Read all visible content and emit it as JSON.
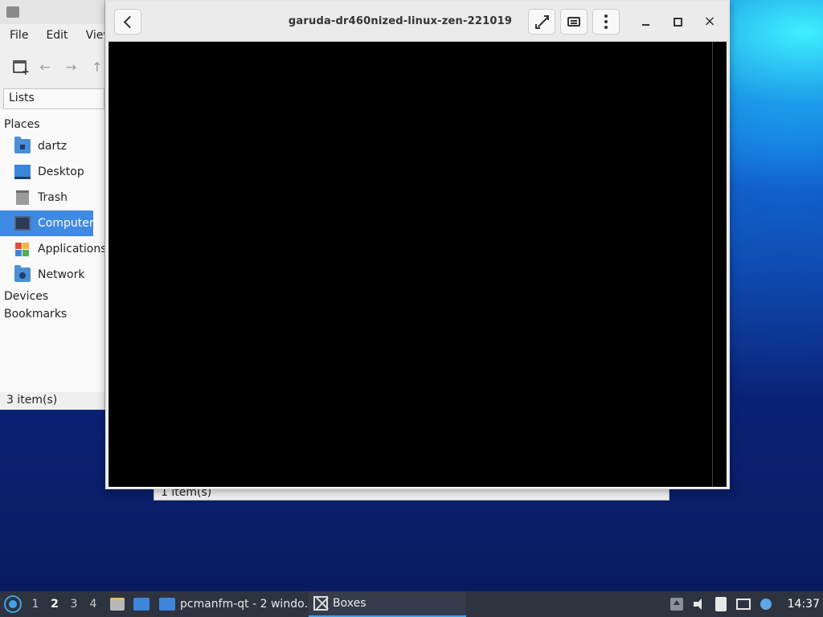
{
  "file_manager": {
    "menu": [
      "File",
      "Edit",
      "View"
    ],
    "view_mode": "Lists",
    "sidebar": {
      "places_header": "Places",
      "items": [
        {
          "label": "dartz",
          "icon": "home-folder-icon",
          "selected": false
        },
        {
          "label": "Desktop",
          "icon": "desktop-icon",
          "selected": false
        },
        {
          "label": "Trash",
          "icon": "trash-icon",
          "selected": false
        },
        {
          "label": "Computer",
          "icon": "computer-icon",
          "selected": true
        },
        {
          "label": "Applications",
          "icon": "applications-icon",
          "selected": false
        },
        {
          "label": "Network",
          "icon": "network-icon",
          "selected": false
        }
      ],
      "devices_header": "Devices",
      "bookmarks_header": "Bookmarks"
    },
    "status": "3 item(s)",
    "second_window_status": "1 item(s)"
  },
  "boxes": {
    "title": "garuda-dr460nized-linux-zen-221019",
    "close_glyph": "×"
  },
  "taskbar": {
    "workspaces": [
      "1",
      "2",
      "3",
      "4"
    ],
    "active_workspace": "2",
    "tasks": [
      {
        "label": "pcmanfm-qt - 2 windo…"
      },
      {
        "label": "Boxes"
      }
    ],
    "clock": "14:37"
  },
  "colors": {
    "selection": "#3f8ae2",
    "taskbar_bg": "#2e3340",
    "vm_display": "#000000"
  }
}
